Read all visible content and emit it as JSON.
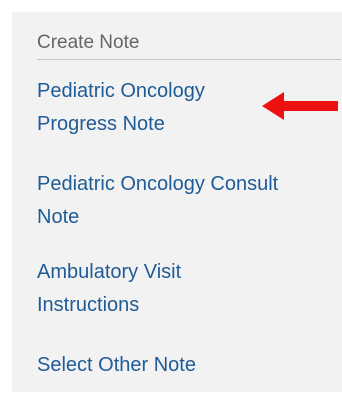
{
  "panel": {
    "header": "Create Note",
    "items": [
      {
        "lines": [
          "Pediatric Oncology",
          "Progress Note"
        ]
      },
      {
        "lines": [
          "Pediatric Oncology Consult",
          "Note"
        ]
      },
      {
        "lines": [
          "Ambulatory Visit",
          "Instructions"
        ]
      },
      {
        "lines": [
          "Select Other Note"
        ]
      }
    ]
  },
  "annotation": {
    "arrow_color": "#ee1111",
    "arrow_icon": "left-arrow-icon"
  },
  "colors": {
    "panel_bg": "#f2f2f2",
    "link": "#1f5b96",
    "header": "#666666"
  }
}
